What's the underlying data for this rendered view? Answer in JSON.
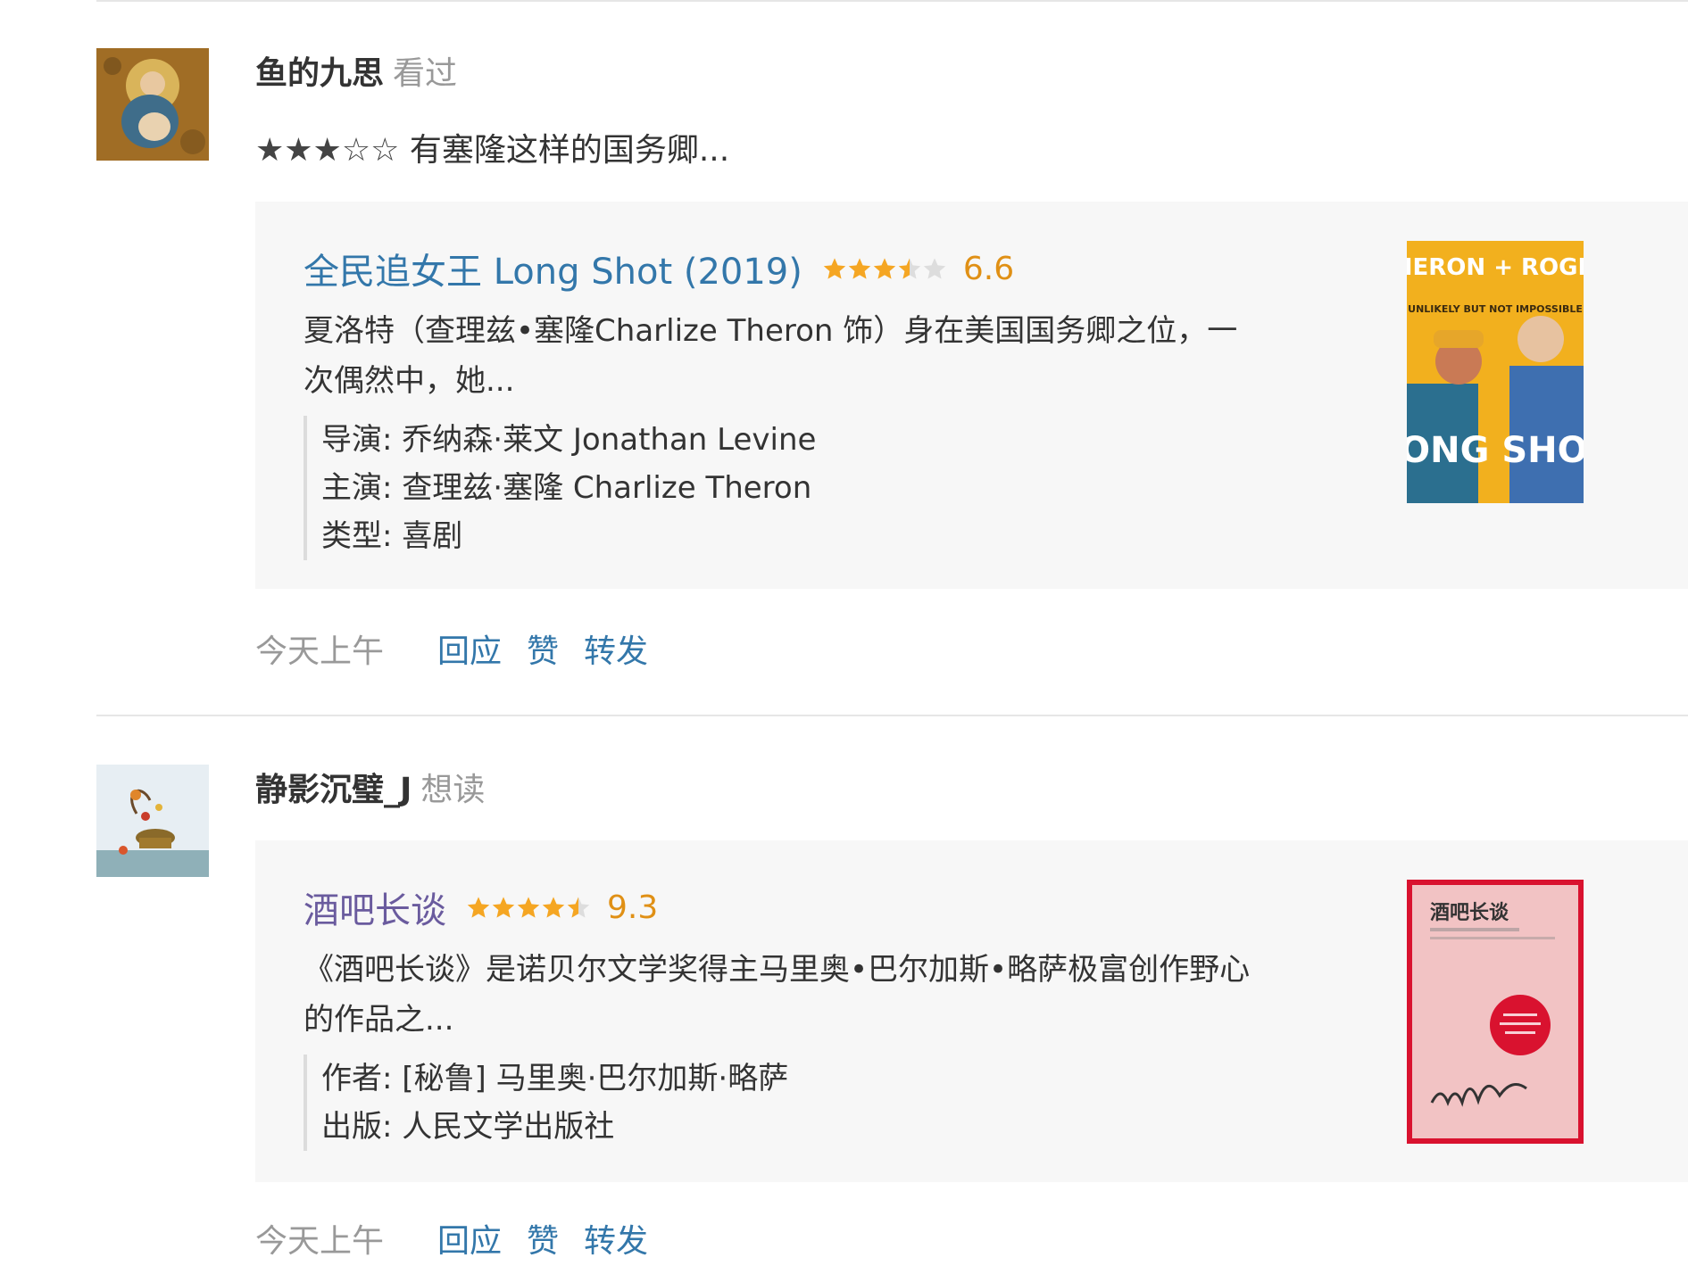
{
  "feed": {
    "items": [
      {
        "user_name": "鱼的九思",
        "action": "看过",
        "rating_stars": "★★★☆☆",
        "comment": "有塞隆这样的国务卿...",
        "subject": {
          "title": "全民追女王 Long Shot (2019)",
          "score": "6.6",
          "star_rating": 3.5,
          "description": "夏洛特（查理兹•塞隆Charlize Theron 饰）身在美国国务卿之位，一次偶然中，她...",
          "meta": [
            "导演: 乔纳森·莱文 Jonathan Levine",
            "主演: 查理兹·塞隆 Charlize Theron",
            "类型: 喜剧"
          ],
          "poster_text": {
            "top": "THERON + ROGEN",
            "middle": "UNLIKELY BUT NOT IMPOSSIBLE",
            "bottom": "LONG SHOT"
          }
        },
        "time": "今天上午",
        "actions": [
          "回应",
          "赞",
          "转发"
        ]
      },
      {
        "user_name": "静影沉璧_J",
        "action": "想读",
        "subject": {
          "title": "酒吧长谈",
          "score": "9.3",
          "star_rating": 4.5,
          "description": "《酒吧长谈》是诺贝尔文学奖得主马里奥•巴尔加斯•略萨极富创作野心的作品之...",
          "meta": [
            "作者: [秘鲁] 马里奥·巴尔加斯·略萨",
            "出版: 人民文学出版社"
          ],
          "cover_text": "酒吧长谈"
        },
        "time": "今天上午",
        "actions": [
          "回应",
          "赞",
          "转发"
        ]
      }
    ]
  },
  "colors": {
    "link": "#3377aa",
    "book_link": "#6a5b9e",
    "score": "#e09015",
    "muted": "#999999",
    "card_bg": "#f7f7f7"
  }
}
